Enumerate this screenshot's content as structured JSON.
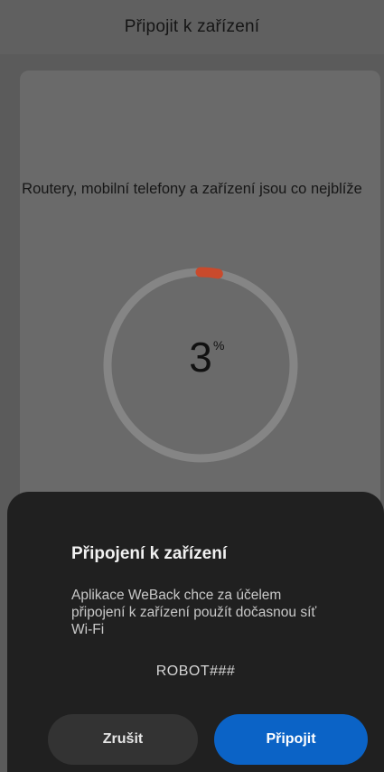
{
  "header": {
    "title": "Připojit k zařízení"
  },
  "main": {
    "hint": "Routery, mobilní telefony a zařízení jsou co nejblíže",
    "progress": {
      "value": "3",
      "unit": "%",
      "fraction": 0.03
    }
  },
  "dialog": {
    "title": "Připojení k zařízení",
    "message": "Aplikace WeBack chce za účelem připojení k zařízení použít dočasnou síť Wi-Fi",
    "network_name": "ROBOT###",
    "cancel_label": "Zrušit",
    "connect_label": "Připojit"
  },
  "colors": {
    "progress_accent": "#c94a2c",
    "ring_track": "#858585",
    "primary_button": "#0b63c6",
    "dialog_background": "#202020"
  }
}
